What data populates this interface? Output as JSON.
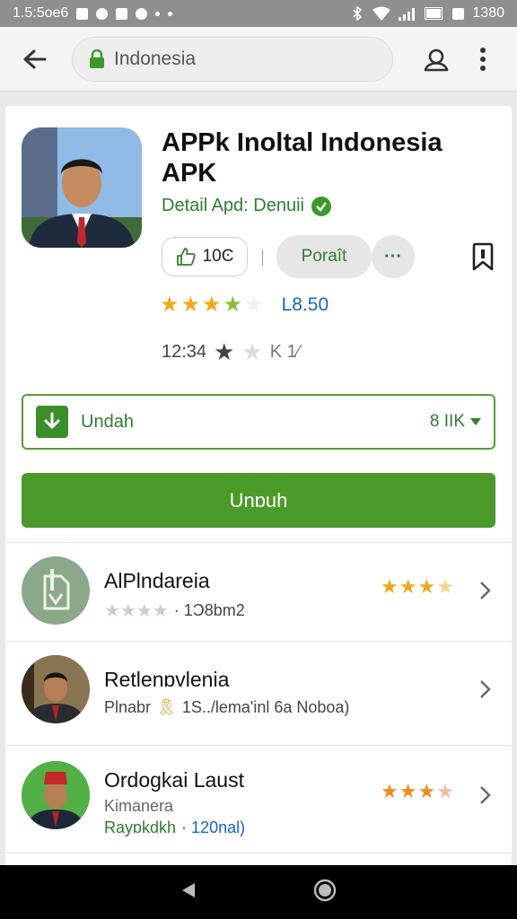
{
  "status_bar": {
    "time_left": "1.5:5oe6",
    "time_right": "1380"
  },
  "browser": {
    "url_text": "Indonesia"
  },
  "app": {
    "title": "APPk Inoltal Indonesia APK",
    "developer": "Detail Apd: Denuii",
    "like_count": "10Ͼ",
    "secondary_button": "Poraît",
    "more_button": "···",
    "rating": 3.5,
    "rating_text": "L8.50",
    "meta_text": "12:34",
    "meta_suffix": "K 1⁄",
    "select_label": "Undah",
    "select_value": "8 IIK",
    "main_button": "Unɒuh"
  },
  "related": [
    {
      "title": "AlPlndareia",
      "sub": "· 1Ͻ8bm2",
      "rating": 3.5
    },
    {
      "title": "Retlenɒvlenia",
      "sub_prefix": "Plnabr",
      "sub": "1S../lema'inl 6a Noboa)"
    },
    {
      "title": "Ordogkai Laust",
      "sub_line1": "Kimanera",
      "sub_line2_prefix": "Rayɒkdkh",
      "sub_line2": "· 120nal)",
      "rating": 3.5
    }
  ],
  "colors": {
    "accent_green": "#4a9a2a",
    "dark_green": "#2e7d32",
    "star_gold": "#f2a81d",
    "link_blue": "#1565c0"
  }
}
